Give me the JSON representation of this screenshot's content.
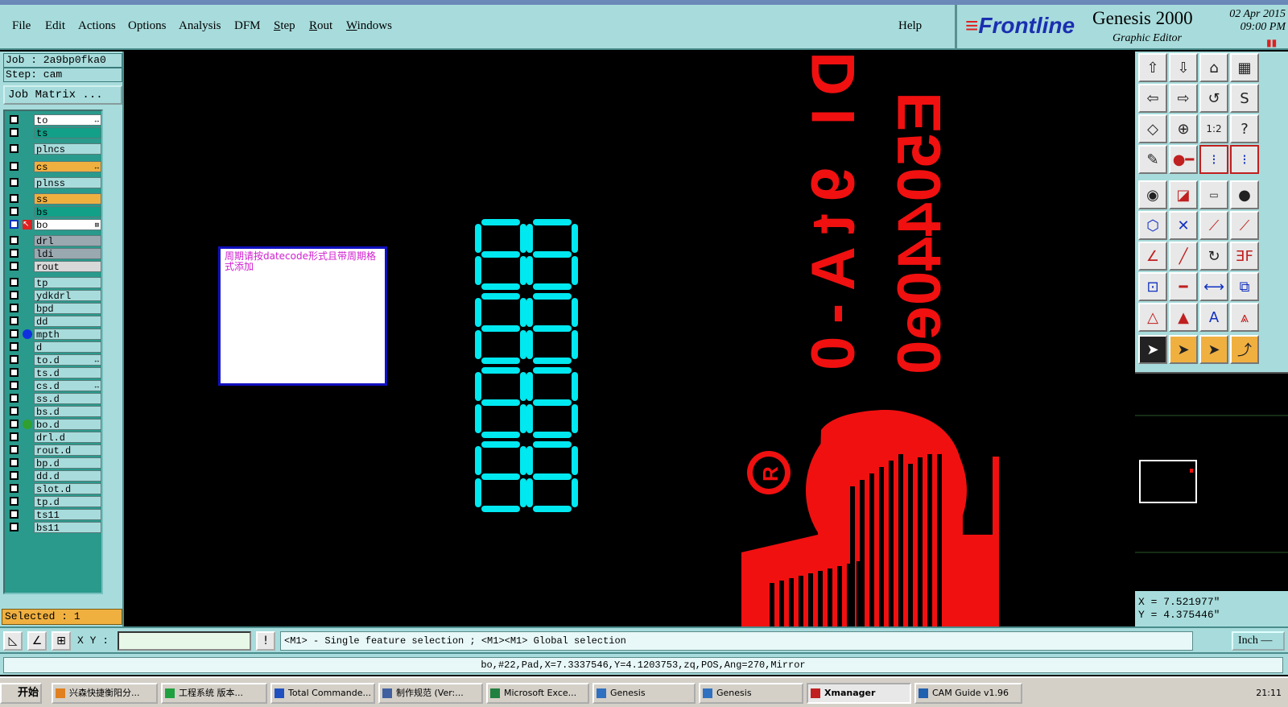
{
  "menu": {
    "items": [
      "File",
      "Edit",
      "Actions",
      "Options",
      "Analysis",
      "DFM",
      "Step",
      "Rout",
      "Windows"
    ],
    "help": "Help"
  },
  "brand": {
    "logo": "Frontline",
    "product": "Genesis 2000",
    "subtitle": "Graphic Editor",
    "date": "02 Apr 2015",
    "time": "09:00 PM"
  },
  "job": {
    "job_line": "Job : 2a9bp0fka0",
    "step_line": "Step: cam",
    "matrix_button": "Job Matrix ..."
  },
  "layers": [
    {
      "name": "to",
      "color": "#ffffff",
      "sym": "↔"
    },
    {
      "name": "ts",
      "color": "#12a088"
    },
    {
      "name": "plncs",
      "color": "#a8dcdc"
    },
    {
      "name": "cs",
      "color": "#f0b040",
      "sym": "↔"
    },
    {
      "name": "plnss",
      "color": "#a8dcdc"
    },
    {
      "name": "ss",
      "color": "#f0b040"
    },
    {
      "name": "bs",
      "color": "#12a088"
    },
    {
      "name": "bo",
      "color": "#ffffff",
      "sym": "⊞",
      "active": true
    },
    {
      "name": "drl",
      "color": "#9aa8b0"
    },
    {
      "name": "ldi",
      "color": "#9aa8b0"
    },
    {
      "name": "rout",
      "color": "#d8d8d8"
    },
    {
      "name": "tp",
      "color": "#a8dcdc"
    },
    {
      "name": "ydkdrl",
      "color": "#a8dcdc"
    },
    {
      "name": "bpd",
      "color": "#a8dcdc"
    },
    {
      "name": "dd",
      "color": "#a8dcdc"
    },
    {
      "name": "mpth",
      "color": "#a8dcdc",
      "dot": "#1030e0"
    },
    {
      "name": "d",
      "color": "#a8dcdc"
    },
    {
      "name": "to.d",
      "color": "#a8dcdc",
      "sym": "↔"
    },
    {
      "name": "ts.d",
      "color": "#a8dcdc"
    },
    {
      "name": "cs.d",
      "color": "#a8dcdc",
      "sym": "↔"
    },
    {
      "name": "ss.d",
      "color": "#a8dcdc"
    },
    {
      "name": "bs.d",
      "color": "#a8dcdc"
    },
    {
      "name": "bo.d",
      "color": "#a8dcdc",
      "dot": "#30a030"
    },
    {
      "name": "drl.d",
      "color": "#a8dcdc"
    },
    {
      "name": "rout.d",
      "color": "#a8dcdc"
    },
    {
      "name": "bp.d",
      "color": "#a8dcdc"
    },
    {
      "name": "dd.d",
      "color": "#a8dcdc"
    },
    {
      "name": "slot.d",
      "color": "#a8dcdc"
    },
    {
      "name": "tp.d",
      "color": "#a8dcdc"
    },
    {
      "name": "ts11",
      "color": "#a8dcdc"
    },
    {
      "name": "bs11",
      "color": "#a8dcdc"
    }
  ],
  "selected": "Selected : 1",
  "canvas": {
    "note": "周期请按datecode形式且带周期格式添加",
    "text1": "DI 9tA-0",
    "text2": "E50440e0",
    "digits": "8888"
  },
  "coords": {
    "x": "X = 7.521977\"",
    "y": "Y = 4.375446\""
  },
  "cmd": {
    "xy_label": "X Y :",
    "xy_value": "",
    "hint": "<M1> - Single feature selection ; <M1><M1> Global selection",
    "unit": "Inch —"
  },
  "status": "bo,#22,Pad,X=7.3337546,Y=4.1203753,zq,POS,Ang=270,Mirror",
  "taskbar": {
    "start": "开始",
    "tasks": [
      "兴森快捷衡阳分...",
      "工程系统   版本...",
      "Total Commande...",
      "制作规范 (Ver:...",
      "Microsoft Exce...",
      "Genesis",
      "Genesis",
      "Xmanager",
      "CAM Guide v1.96"
    ],
    "clock": "21:11"
  }
}
